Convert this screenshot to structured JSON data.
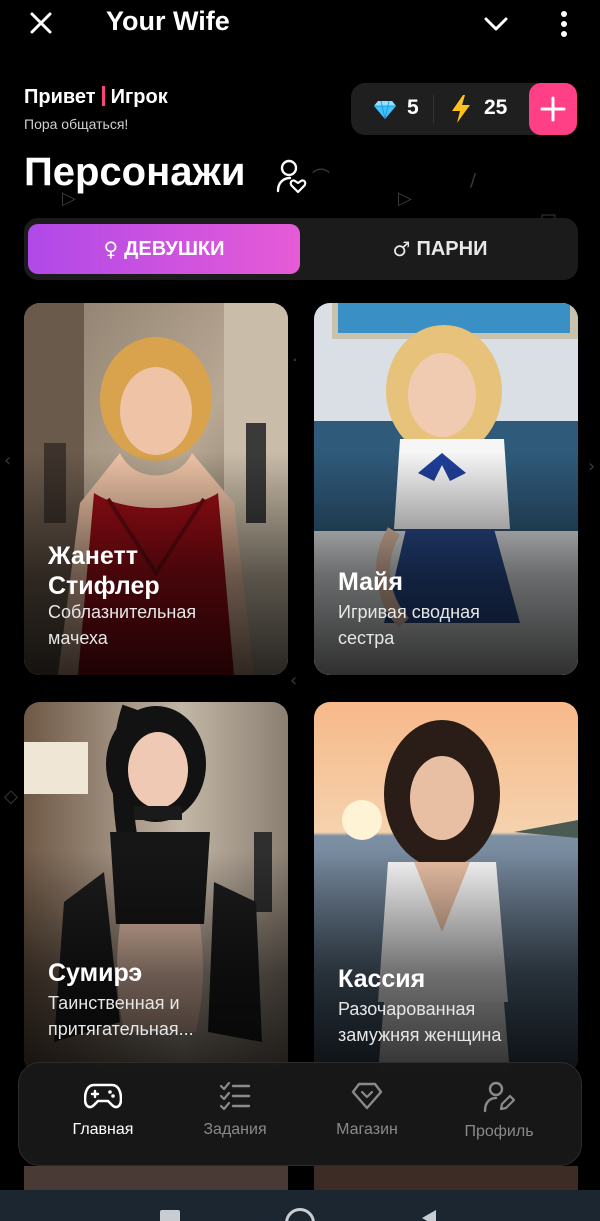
{
  "app": {
    "title": "Your Wife"
  },
  "greeting": {
    "hello": "Привет",
    "name": "Игрок",
    "subtitle": "Пора общаться!"
  },
  "currency": {
    "gems": "5",
    "energy": "25"
  },
  "section": {
    "title": "Персонажи"
  },
  "tabs": [
    {
      "symbol": "♀",
      "label": "ДЕВУШКИ",
      "active": true
    },
    {
      "symbol": "♂",
      "label": "ПАРНИ",
      "active": false
    }
  ],
  "characters": [
    {
      "name_line1": "Жанетт",
      "name_line2": "Стифлер",
      "desc_line1": "Соблазнительная",
      "desc_line2": "мачеха"
    },
    {
      "name_line1": "Майя",
      "desc_line1": "Игривая сводная",
      "desc_line2": "сестра"
    },
    {
      "name_line1": "Сумирэ",
      "desc_line1": "Таинственная и",
      "desc_line2": "притягательная..."
    },
    {
      "name_line1": "Кассия",
      "desc_line1": "Разочарованная",
      "desc_line2": "замужняя женщина"
    }
  ],
  "nav": [
    {
      "label": "Главная",
      "icon": "gamepad-icon",
      "active": true
    },
    {
      "label": "Задания",
      "icon": "checklist-icon",
      "active": false
    },
    {
      "label": "Магазин",
      "icon": "diamond-icon",
      "active": false
    },
    {
      "label": "Профиль",
      "icon": "profile-icon",
      "active": false
    }
  ],
  "colors": {
    "accent_pink": "#ff3f86",
    "tab_gradient_start": "#b049e8",
    "tab_gradient_end": "#e65bd6",
    "gem_blue": "#3fc4ff",
    "bolt_yellow": "#ffc21a"
  }
}
